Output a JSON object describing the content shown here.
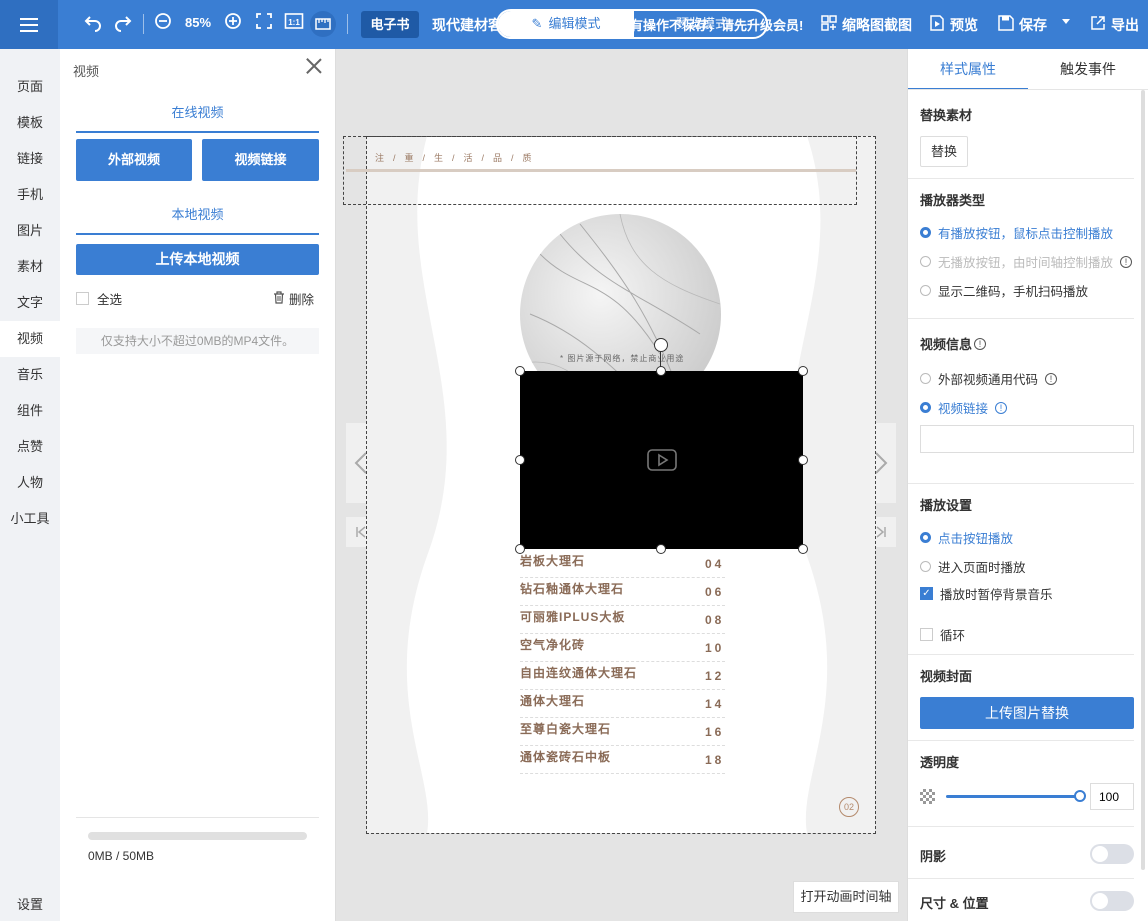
{
  "toolbar": {
    "zoom": "85%",
    "fit_label": "1:1",
    "ebook_tag": "电子书",
    "doc_title": "现代建材客",
    "mode_edit": "编辑模式",
    "mode_preview": "预览模式",
    "marquee": "有操作不保存，请先升级会员!",
    "thumb_label": "缩略图截图",
    "preview_label": "预览",
    "save_label": "保存",
    "export_label": "导出"
  },
  "leftnav": {
    "items": [
      "页面",
      "模板",
      "链接",
      "手机",
      "图片",
      "素材",
      "文字",
      "视频",
      "音乐",
      "组件",
      "点赞",
      "人物",
      "小工具"
    ],
    "settings": "设置"
  },
  "video_panel": {
    "title": "视频",
    "online_head": "在线视频",
    "external_btn": "外部视频",
    "link_btn": "视频链接",
    "local_head": "本地视频",
    "upload_btn": "上传本地视频",
    "select_all": "全选",
    "delete": "删除",
    "hint": "仅支持大小不超过0MB的MP4文件。",
    "storage_text": "0MB / 50MB",
    "storage_fraction": 0
  },
  "page": {
    "ribbon": "注/重/生/活/品/质",
    "marble_caption": "* 图片源于网络，禁止商业用途",
    "toc": [
      {
        "title": "岩板大理石",
        "num": "04"
      },
      {
        "title": "钻石釉通体大理石",
        "num": "06"
      },
      {
        "title": "可丽雅IPLUS大板",
        "num": "08"
      },
      {
        "title": "空气净化砖",
        "num": "10"
      },
      {
        "title": "自由连纹通体大理石",
        "num": "12"
      },
      {
        "title": "通体大理石",
        "num": "14"
      },
      {
        "title": "至尊白瓷大理石",
        "num": "16"
      },
      {
        "title": "通体瓷砖石中板",
        "num": "18"
      }
    ],
    "page_number": "02"
  },
  "canvas": {
    "timeline_btn": "打开动画时间轴"
  },
  "right_panel": {
    "tab_style": "样式属性",
    "tab_events": "触发事件",
    "replace_head": "替换素材",
    "replace_btn": "替换",
    "player_head": "播放器类型",
    "player_opt1": "有播放按钮，鼠标点击控制播放",
    "player_opt2": "无播放按钮，由时间轴控制播放",
    "player_opt3": "显示二维码，手机扫码播放",
    "info_head": "视频信息",
    "info_opt1": "外部视频通用代码",
    "info_opt2": "视频链接",
    "link_value": "",
    "play_head": "播放设置",
    "play_opt1": "点击按钮播放",
    "play_opt2": "进入页面时播放",
    "pause_bgm": "播放时暂停背景音乐",
    "loop": "循环",
    "cover_head": "视频封面",
    "cover_btn": "上传图片替换",
    "opacity_head": "透明度",
    "opacity_value": "100",
    "shadow_head": "阴影",
    "size_head": "尺寸 & 位置"
  },
  "colors": {
    "accent": "#3a7ed3",
    "toc_text": "#8a6b57"
  }
}
